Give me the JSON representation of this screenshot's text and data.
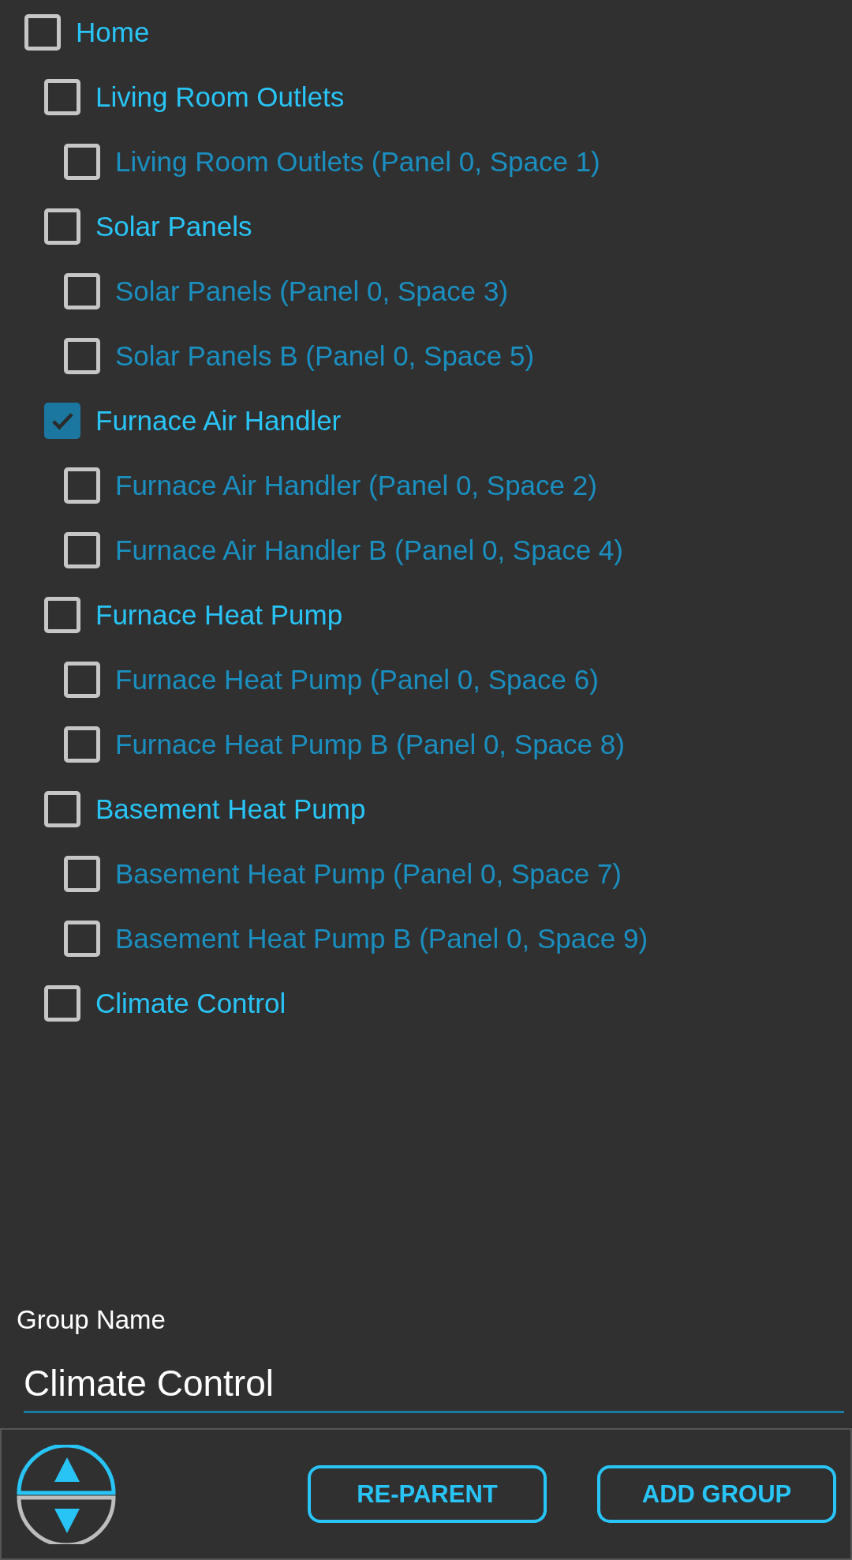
{
  "tree": [
    {
      "label": "Home",
      "kind": "group",
      "checked": false,
      "children": [
        {
          "label": "Living Room Outlets",
          "kind": "group",
          "checked": false,
          "children": [
            {
              "label": "Living Room Outlets (Panel 0, Space 1)",
              "kind": "circuit",
              "checked": false
            }
          ]
        },
        {
          "label": "Solar Panels",
          "kind": "group",
          "checked": false,
          "children": [
            {
              "label": "Solar Panels (Panel 0, Space 3)",
              "kind": "circuit",
              "checked": false
            },
            {
              "label": "Solar Panels B (Panel 0, Space 5)",
              "kind": "circuit",
              "checked": false
            }
          ]
        },
        {
          "label": "Furnace Air Handler",
          "kind": "group",
          "checked": true,
          "children": [
            {
              "label": "Furnace Air Handler (Panel 0, Space 2)",
              "kind": "circuit",
              "checked": false
            },
            {
              "label": "Furnace Air Handler B (Panel 0, Space 4)",
              "kind": "circuit",
              "checked": false
            }
          ]
        },
        {
          "label": "Furnace Heat Pump",
          "kind": "group",
          "checked": false,
          "children": [
            {
              "label": "Furnace Heat Pump (Panel 0, Space 6)",
              "kind": "circuit",
              "checked": false
            },
            {
              "label": "Furnace Heat Pump B (Panel 0, Space 8)",
              "kind": "circuit",
              "checked": false
            }
          ]
        },
        {
          "label": "Basement Heat Pump",
          "kind": "group",
          "checked": false,
          "children": [
            {
              "label": "Basement Heat Pump (Panel 0, Space 7)",
              "kind": "circuit",
              "checked": false
            },
            {
              "label": "Basement Heat Pump B (Panel 0, Space 9)",
              "kind": "circuit",
              "checked": false
            }
          ]
        },
        {
          "label": "Climate Control",
          "kind": "group",
          "checked": false
        }
      ]
    }
  ],
  "group_name": {
    "label": "Group Name",
    "value": "Climate Control"
  },
  "buttons": [
    "RE-PARENT",
    "ADD GROUP"
  ]
}
